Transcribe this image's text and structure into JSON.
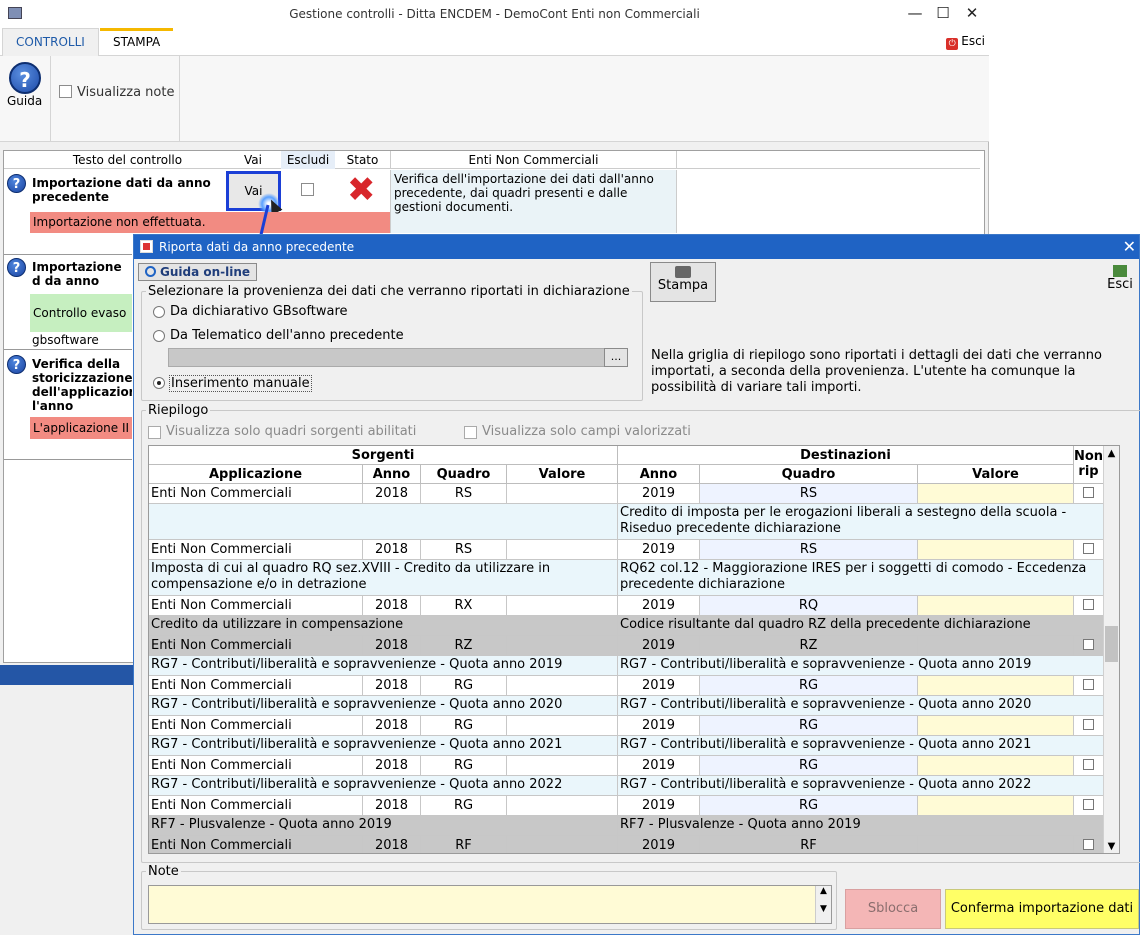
{
  "window": {
    "title": "Gestione controlli - Ditta ENCDEM - DemoCont Enti non Commerciali"
  },
  "ribbon": {
    "tabs": [
      "CONTROLLI",
      "STAMPA"
    ],
    "esci": "Esci",
    "guida": "Guida",
    "visualizza_note": "Visualizza note"
  },
  "grid": {
    "headers": {
      "testo": "Testo del controllo",
      "vai": "Vai",
      "escludi": "Escludi",
      "stato": "Stato",
      "enti": "Enti Non Commerciali"
    },
    "rows": [
      {
        "title": "Importazione dati da anno precedente",
        "vai": "Vai",
        "status": "Importazione non effettuata.",
        "desc": "Verifica dell'importazione dei dati dall'anno precedente, dai quadri presenti e dalle gestioni documenti."
      },
      {
        "title": "Importazione d da anno precec",
        "status": "Controllo evaso",
        "sub": "gbsoftware"
      },
      {
        "title": "Verifica della storicizzazione dell'applicazior l'anno corrente",
        "status": "L'applicazione II"
      }
    ]
  },
  "dialog": {
    "title": "Riporta dati da anno precedente",
    "guida_online": "Guida on-line",
    "stampa": "Stampa",
    "esci": "Esci",
    "provenienza_legend": "Selezionare la provenienza dei dati che verranno riportati in dichiarazione",
    "options": [
      "Da dichiarativo GBsoftware",
      "Da Telematico dell'anno precedente",
      "Inserimento manuale"
    ],
    "selected_option": "Inserimento manuale",
    "browse": "...",
    "info": "Nella griglia di riepilogo sono riportati i dettagli dei dati che verranno importati, a seconda della provenienza. L'utente ha comunque la possibilità di variare tali importi.",
    "riepilogo_legend": "Riepilogo",
    "chk_sorgenti": "Visualizza solo quadri sorgenti abilitati",
    "chk_campi": "Visualizza solo campi valorizzati",
    "table": {
      "group_sorgenti": "Sorgenti",
      "group_destinazioni": "Destinazioni",
      "col_applicazione": "Applicazione",
      "col_anno": "Anno",
      "col_quadro": "Quadro",
      "col_valore": "Valore",
      "col_anno_d": "Anno",
      "col_quadro_d": "Quadro",
      "col_valore_d": "Valore",
      "col_nonrip": "Non rip",
      "groups": [
        {
          "src_desc": "",
          "dst_desc": "",
          "app": "Enti Non Commerciali",
          "anno": "2018",
          "quadro": "RS",
          "anno_d": "2019",
          "quadro_d": "RS",
          "grey": false,
          "first": true
        },
        {
          "src_desc": "",
          "dst_desc": "Credito di imposta per le erogazioni liberali a sestegno della scuola - Riseduo precedente dichiarazione",
          "app": "Enti Non Commerciali",
          "anno": "2018",
          "quadro": "RS",
          "anno_d": "2019",
          "quadro_d": "RS",
          "grey": false
        },
        {
          "src_desc": "Imposta di cui al quadro RQ sez.XVIII - Credito da utilizzare in compensazione e/o in detrazione",
          "dst_desc": "RQ62 col.12 - Maggiorazione IRES per i soggetti di comodo - Eccedenza precedente dichiarazione",
          "app": "Enti Non Commerciali",
          "anno": "2018",
          "quadro": "RX",
          "anno_d": "2019",
          "quadro_d": "RQ",
          "grey": false
        },
        {
          "src_desc": "Credito da utilizzare in compensazione",
          "dst_desc": "Codice risultante dal quadro RZ della precedente dichiarazione",
          "app": "Enti Non Commerciali",
          "anno": "2018",
          "quadro": "RZ",
          "anno_d": "2019",
          "quadro_d": "RZ",
          "grey": true
        },
        {
          "src_desc": "RG7 - Contributi/liberalità e sopravvenienze - Quota anno 2019",
          "dst_desc": "RG7 - Contributi/liberalità e sopravvenienze - Quota anno 2019",
          "app": "Enti Non Commerciali",
          "anno": "2018",
          "quadro": "RG",
          "anno_d": "2019",
          "quadro_d": "RG",
          "grey": false
        },
        {
          "src_desc": "RG7 - Contributi/liberalità e sopravvenienze - Quota anno 2020",
          "dst_desc": "RG7 - Contributi/liberalità e sopravvenienze - Quota anno 2020",
          "app": "Enti Non Commerciali",
          "anno": "2018",
          "quadro": "RG",
          "anno_d": "2019",
          "quadro_d": "RG",
          "grey": false
        },
        {
          "src_desc": "RG7 - Contributi/liberalità e sopravvenienze - Quota anno 2021",
          "dst_desc": "RG7 - Contributi/liberalità e sopravvenienze - Quota anno 2021",
          "app": "Enti Non Commerciali",
          "anno": "2018",
          "quadro": "RG",
          "anno_d": "2019",
          "quadro_d": "RG",
          "grey": false
        },
        {
          "src_desc": "RG7 - Contributi/liberalità e sopravvenienze - Quota anno 2022",
          "dst_desc": "RG7 - Contributi/liberalità e sopravvenienze - Quota anno 2022",
          "app": "Enti Non Commerciali",
          "anno": "2018",
          "quadro": "RG",
          "anno_d": "2019",
          "quadro_d": "RG",
          "grey": false
        },
        {
          "src_desc": "RF7 - Plusvalenze  - Quota anno 2019",
          "dst_desc": "RF7 - Plusvalenze  - Quota anno 2019",
          "app": "Enti Non Commerciali",
          "anno": "2018",
          "quadro": "RF",
          "anno_d": "2019",
          "quadro_d": "RF",
          "grey": true
        }
      ]
    },
    "note_legend": "Note",
    "sblocca": "Sblocca",
    "conferma": "Conferma importazione dati"
  },
  "colors": {
    "accent": "#1f63c4",
    "status_error": "#f28b82",
    "status_ok": "#c6efc0",
    "confirm": "#ffff66",
    "sblocca": "#f4b6b6",
    "dest_cell": "#eef3ff",
    "val_cell": "#fffbd6",
    "grey_row": "#c8c8c8"
  }
}
